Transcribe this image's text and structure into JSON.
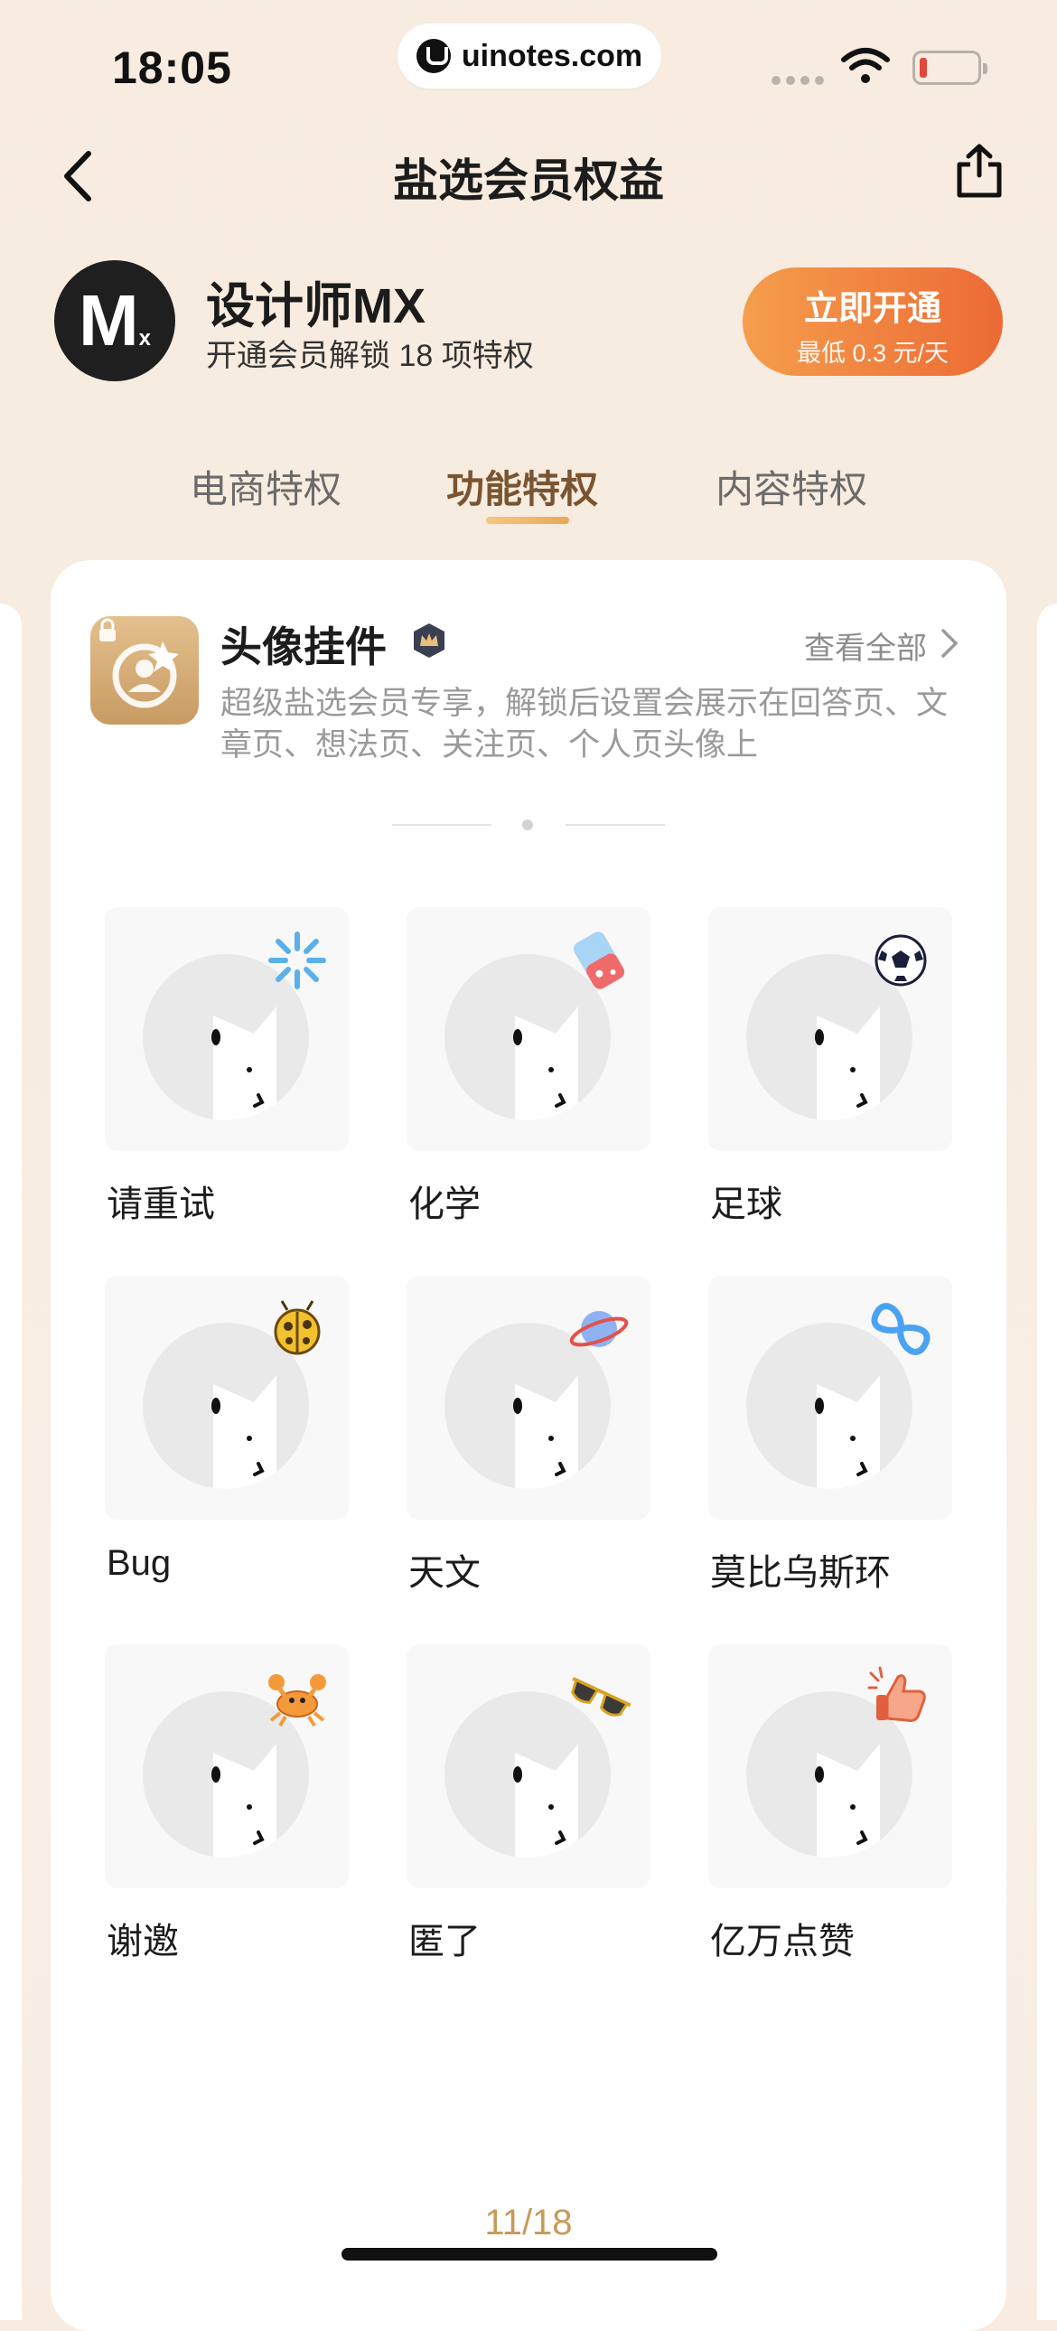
{
  "status_bar": {
    "time": "18:05",
    "url": "uinotes.com"
  },
  "nav": {
    "title": "盐选会员权益",
    "back_icon": "chevron-left-icon",
    "share_icon": "share-icon"
  },
  "member": {
    "avatar_text": "M",
    "avatar_sub": "x",
    "name": "设计师MX",
    "subtitle": "开通会员解锁 18 项特权",
    "cta_main": "立即开通",
    "cta_sub": "最低 0.3 元/天"
  },
  "tabs": [
    {
      "label": "电商特权",
      "active": false
    },
    {
      "label": "功能特权",
      "active": true
    },
    {
      "label": "内容特权",
      "active": false
    }
  ],
  "feature": {
    "title": "头像挂件",
    "see_all": "查看全部",
    "description": "超级盐选会员专享，解锁后设置会展示在回答页、文章页、想法页、关注页、个人页头像上"
  },
  "pendants": [
    {
      "label": "请重试",
      "icon": "sparkle-icon"
    },
    {
      "label": "化学",
      "icon": "beaker-icon"
    },
    {
      "label": "足球",
      "icon": "soccer-ball-icon"
    },
    {
      "label": "Bug",
      "icon": "ladybug-icon"
    },
    {
      "label": "天文",
      "icon": "planet-icon"
    },
    {
      "label": "莫比乌斯环",
      "icon": "mobius-ring-icon"
    },
    {
      "label": "谢邀",
      "icon": "crab-icon"
    },
    {
      "label": "匿了",
      "icon": "sunglasses-icon"
    },
    {
      "label": "亿万点赞",
      "icon": "thumbs-up-icon"
    }
  ],
  "pager": "11/18",
  "colors": {
    "accent": "#7a5430",
    "cta_start": "#f59e4c",
    "cta_end": "#ec6a35",
    "pager": "#c79a5a"
  }
}
